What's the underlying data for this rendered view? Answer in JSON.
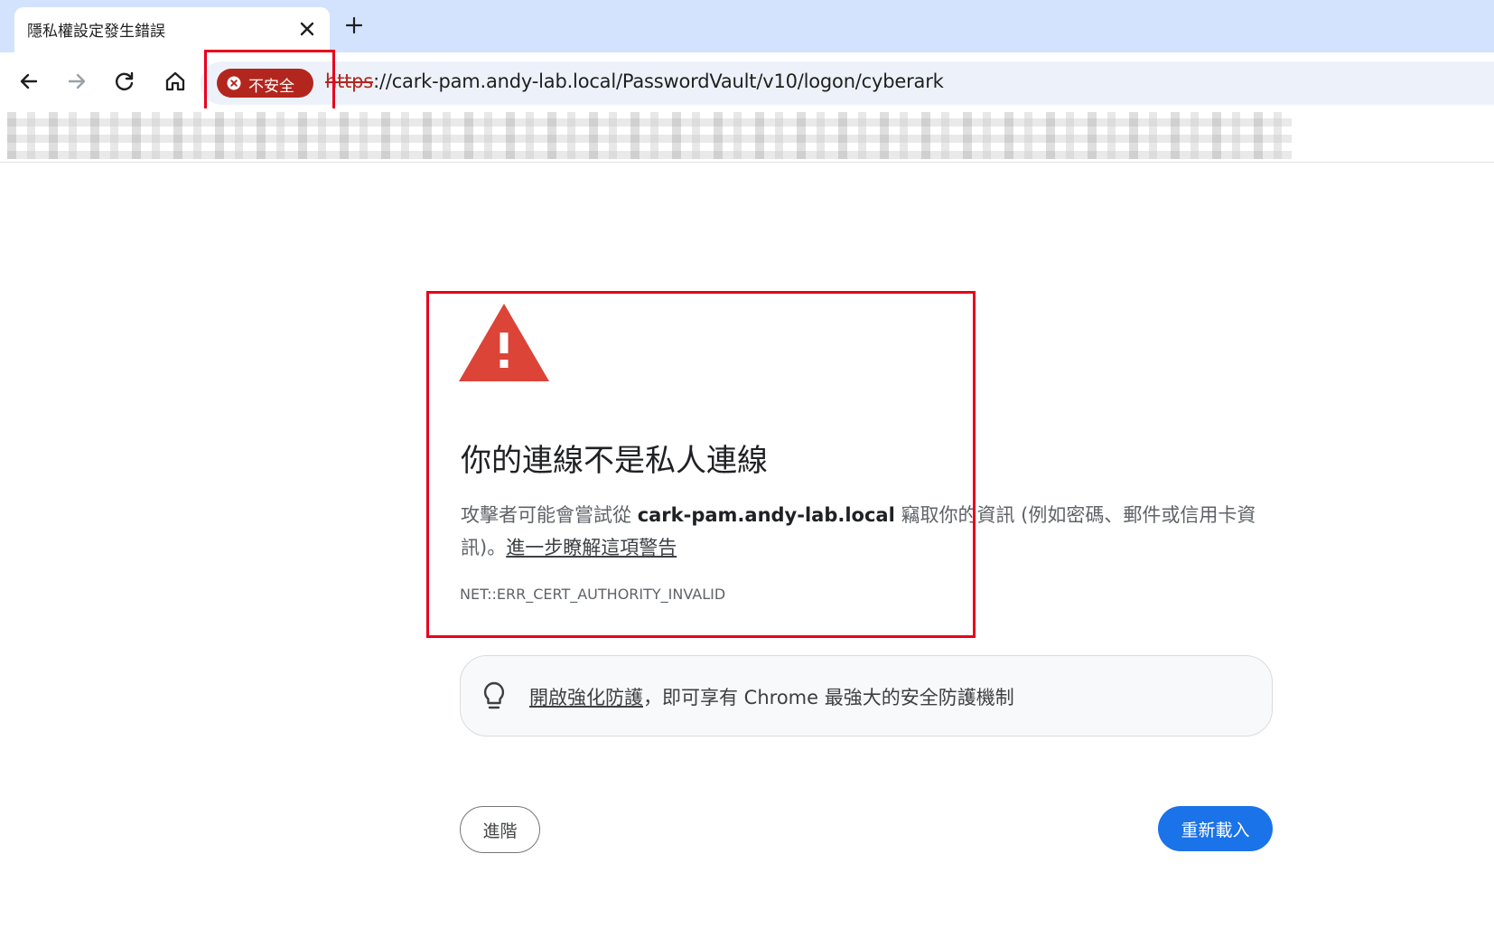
{
  "tab": {
    "title": "隱私權設定發生錯誤",
    "close_icon": "close-icon",
    "new_tab_icon": "plus-icon"
  },
  "toolbar": {
    "icons": [
      "back-arrow-icon",
      "forward-arrow-icon",
      "reload-icon",
      "home-icon"
    ],
    "security_chip": {
      "label": "不安全",
      "icon": "error-circle-icon",
      "color": "#b3261e"
    },
    "url": {
      "scheme": "https",
      "rest": "://cark-pam.andy-lab.local/PasswordVault/v10/logon/cyberark"
    }
  },
  "interstitial": {
    "icon": "warning-triangle-icon",
    "icon_color": "#db4437",
    "heading": "你的連線不是私人連線",
    "description_before": "攻擊者可能會嘗試從 ",
    "description_host": "cark-pam.andy-lab.local",
    "description_after": " 竊取你的資訊 (例如密碼、郵件或信用卡資訊)。",
    "learn_more_link": "進一步瞭解這項警告",
    "error_code": "NET::ERR_CERT_AUTHORITY_INVALID",
    "enhanced_protection": {
      "icon": "lightbulb-icon",
      "link": "開啟強化防護",
      "text": "，即可享有 Chrome 最強大的安全防護機制"
    },
    "advanced_button": "進階",
    "reload_button": "重新載入",
    "reload_button_color": "#1a73e8"
  },
  "annotations": {
    "highlight_color": "#e8001c"
  }
}
